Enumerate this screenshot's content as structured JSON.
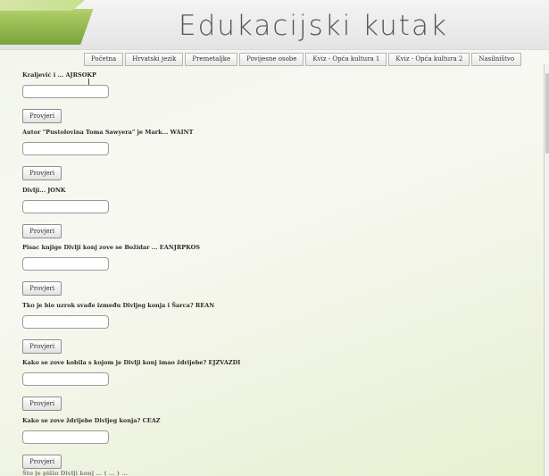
{
  "header": {
    "title": "Edukacijski kutak"
  },
  "nav": {
    "items": [
      "Početna",
      "Hrvatski jezik",
      "Premetaljke",
      "Povijesne osobe",
      "Kviz - Opća kultura 1",
      "Kviz - Opća kultura 2",
      "Nasilništvo"
    ]
  },
  "quiz": {
    "button_label": "Provjeri",
    "questions": [
      {
        "text": "Kraljević i ... AJRSOKP",
        "answer": ""
      },
      {
        "text": "Autor \"Pustolovina Toma Sawyera\" je Mark... WAINT",
        "answer": ""
      },
      {
        "text": "Divlji... JONK",
        "answer": ""
      },
      {
        "text": "Pisac knjige Divlji konj zove se Božidar ... EANJRPKOS",
        "answer": ""
      },
      {
        "text": "Tko je bio uzrok svađe između Divljeg konja i Šarca? REAN",
        "answer": ""
      },
      {
        "text": "Kako se zove kobila s kojom je Divlji konj imao ždrijebe? EJZVAZDI",
        "answer": ""
      },
      {
        "text": "Kako se zove ždrijebe Divljeg konja? CEAZ",
        "answer": ""
      }
    ],
    "partial_next_question": "Što je pišio Divlji konj ... ( ... ) ... "
  },
  "icons": {
    "cursor": "text-cursor-icon"
  }
}
